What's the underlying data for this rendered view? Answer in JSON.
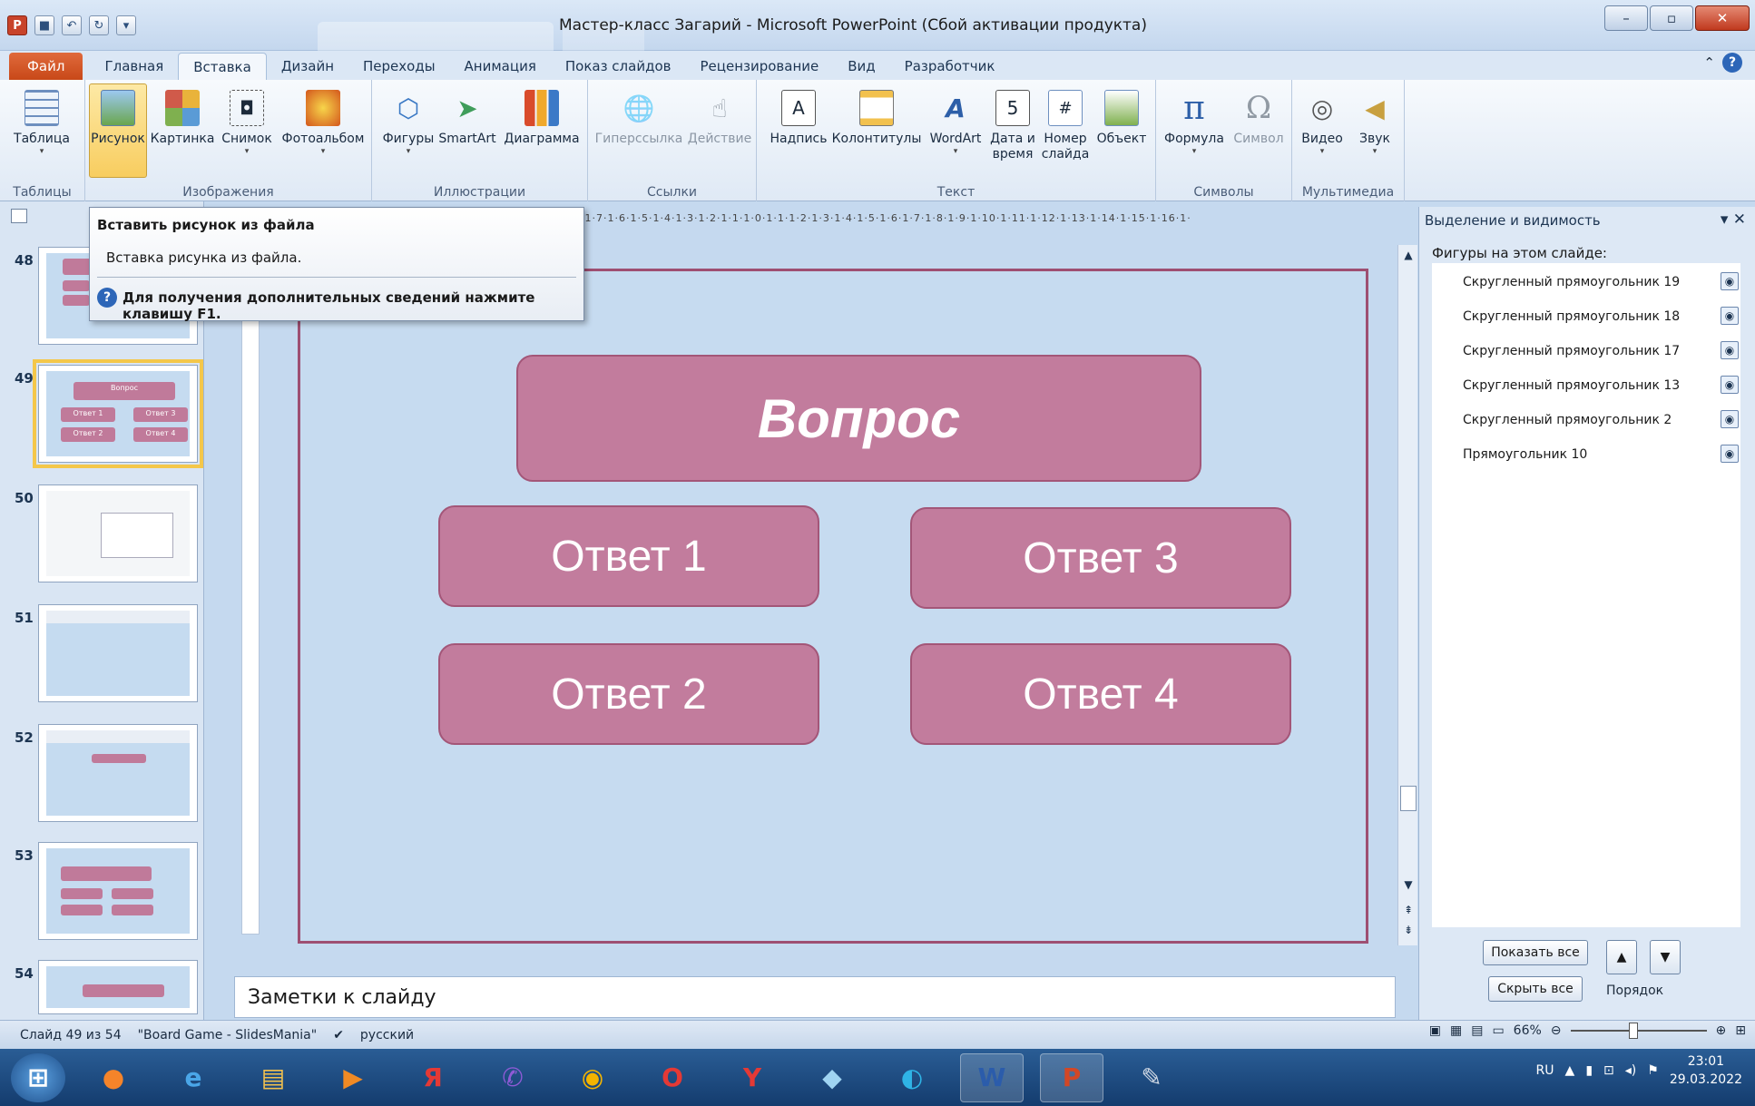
{
  "window": {
    "title": "Мастер-класс Загарий - Microsoft PowerPoint (Сбой активации продукта)"
  },
  "tabs": [
    {
      "label": "Файл"
    },
    {
      "label": "Главная"
    },
    {
      "label": "Вставка"
    },
    {
      "label": "Дизайн"
    },
    {
      "label": "Переходы"
    },
    {
      "label": "Анимация"
    },
    {
      "label": "Показ слайдов"
    },
    {
      "label": "Рецензирование"
    },
    {
      "label": "Вид"
    },
    {
      "label": "Разработчик"
    }
  ],
  "ribbon": {
    "groups": {
      "tables": "Таблицы",
      "images": "Изображения",
      "illustrations": "Иллюстрации",
      "links": "Ссылки",
      "text": "Текст",
      "symbols": "Символы",
      "media": "Мультимедиа"
    },
    "buttons": {
      "table": "Таблица",
      "picture": "Рисунок",
      "clipart": "Картинка",
      "screenshot": "Снимок",
      "album": "Фотоальбом",
      "shapes": "Фигуры",
      "smartart": "SmartArt",
      "chart": "Диаграмма",
      "hyperlink": "Гиперссылка",
      "action": "Действие",
      "textbox": "Надпись",
      "headerfooter": "Колонтитулы",
      "wordart": "WordArt",
      "datetime": "Дата и время",
      "slidenum": "Номер слайда",
      "object": "Объект",
      "equation": "Формула",
      "symbol": "Символ",
      "video": "Видео",
      "audio": "Звук"
    }
  },
  "tooltip": {
    "title": "Вставить рисунок из файла",
    "desc": "Вставка рисунка из файла.",
    "help": "Для получения дополнительных сведений нажмите клавишу F1."
  },
  "thumbnails": [
    {
      "num": "48"
    },
    {
      "num": "49"
    },
    {
      "num": "50"
    },
    {
      "num": "51"
    },
    {
      "num": "52"
    },
    {
      "num": "53"
    },
    {
      "num": "54"
    }
  ],
  "ruler": {
    "h": "·1·7·1·6·1·5·1·4·1·3·1·2·1·1·1·0·1·1·1·2·1·3·1·4·1·5·1·6·1·7·1·8·1·9·1·10·1·11·1·12·1·13·1·14·1·15·1·16·1·"
  },
  "slide": {
    "question": "Вопрос",
    "a1": "Ответ 1",
    "a2": "Ответ 2",
    "a3": "Ответ 3",
    "a4": "Ответ 4"
  },
  "mini": {
    "q": "Вопрос",
    "a1": "Ответ 1",
    "a2": "Ответ 2",
    "a3": "Ответ 3",
    "a4": "Ответ 4"
  },
  "selection_pane": {
    "title": "Выделение и видимость",
    "subtitle": "Фигуры на этом слайде:",
    "items": [
      "Скругленный прямоугольник 19",
      "Скругленный прямоугольник 18",
      "Скругленный прямоугольник 17",
      "Скругленный прямоугольник 13",
      "Скругленный прямоугольник 2",
      "Прямоугольник 10"
    ],
    "show_all": "Показать все",
    "hide_all": "Скрыть все",
    "order": "Порядок"
  },
  "notes": {
    "placeholder": "Заметки к слайду"
  },
  "status": {
    "slide": "Слайд 49 из 54",
    "theme": "\"Board Game - SlidesMania\"",
    "lang": "русский",
    "zoom": "66%"
  },
  "tray": {
    "lang": "RU",
    "time": "23:01",
    "date": "29.03.2022"
  },
  "colors": {
    "shape": "#c27c9d",
    "slide_bg": "#c6dbf0",
    "accent": "#f8cd5f"
  }
}
